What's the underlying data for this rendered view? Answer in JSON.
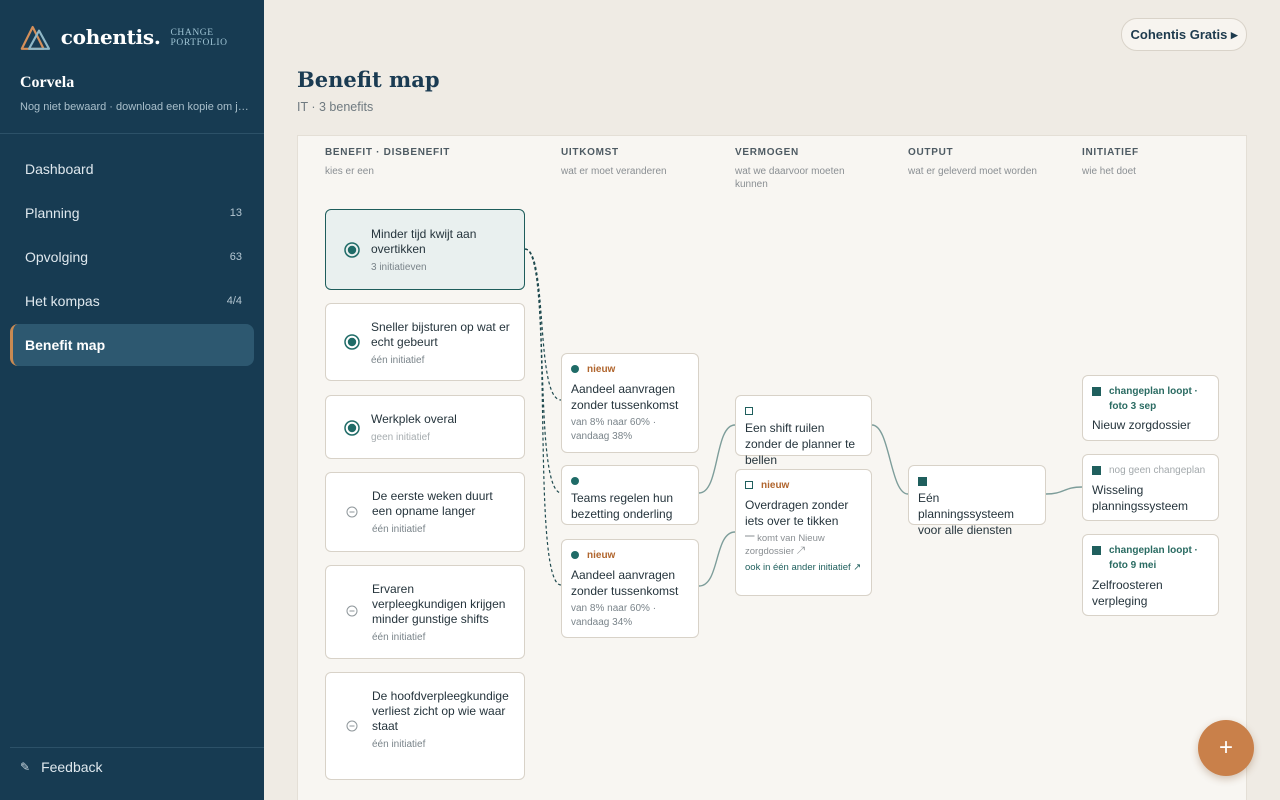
{
  "brand": {
    "name": "cohentis.",
    "tagline": "CHANGE PORTFOLIO"
  },
  "org": {
    "name": "Corvela",
    "status": "Nog niet bewaard · download een kopie om je ..."
  },
  "nav": [
    {
      "label": "Dashboard",
      "count": ""
    },
    {
      "label": "Planning",
      "count": "13"
    },
    {
      "label": "Opvolging",
      "count": "63"
    },
    {
      "label": "Het kompas",
      "count": "4/4"
    },
    {
      "label": "Benefit map",
      "count": ""
    }
  ],
  "feedback": {
    "icon": "pencil-icon",
    "label": "Feedback"
  },
  "header": {
    "gratis_label": "Cohentis Gratis ▸"
  },
  "page": {
    "title": "Benefit map",
    "subtitle": "IT · 3 benefits"
  },
  "columns": [
    {
      "title": "BENEFIT · DISBENEFIT",
      "sub": "kies er een"
    },
    {
      "title": "UITKOMST",
      "sub": "wat er moet veranderen"
    },
    {
      "title": "VERMOGEN",
      "sub": "wat we daarvoor moeten kunnen"
    },
    {
      "title": "OUTPUT",
      "sub": "wat er geleverd moet worden"
    },
    {
      "title": "INITIATIEF",
      "sub": "wie het doet"
    }
  ],
  "benefits": [
    {
      "title": "Minder tijd kwijt aan overtikken",
      "sub": "3 initiatieven",
      "kind": "benefit",
      "selected": true
    },
    {
      "title": "Sneller bijsturen op wat er echt gebeurt",
      "sub": "één initiatief",
      "kind": "benefit"
    },
    {
      "title": "Werkplek overal",
      "sub": "geen initiatief",
      "kind": "benefit"
    },
    {
      "title": "De eerste weken duurt een opname langer",
      "sub": "één initiatief",
      "kind": "disbenefit"
    },
    {
      "title": "Ervaren verpleegkundigen krijgen minder gunstige shifts",
      "sub": "één initiatief",
      "kind": "disbenefit"
    },
    {
      "title": "De hoofdverpleegkundige verliest zicht op wie waar staat",
      "sub": "één initiatief",
      "kind": "disbenefit"
    }
  ],
  "outcomes": [
    {
      "tag": "nieuw",
      "title": "Aandeel aanvragen zonder tussenkomst",
      "sub": "van 8% naar 60% · vandaag 38%"
    },
    {
      "tag": "",
      "title": "Teams regelen hun bezetting onderling",
      "sub": ""
    },
    {
      "tag": "nieuw",
      "title": "Aandeel aanvragen zonder tussenkomst",
      "sub": "van 8% naar 60% · vandaag 34%"
    }
  ],
  "capabilities": [
    {
      "tag": "",
      "title": "Een shift ruilen zonder de planner te bellen"
    },
    {
      "tag": "nieuw",
      "title": "Overdragen zonder iets over te tikken",
      "note": "⎻ komt van Nieuw zorgdossier ↗",
      "link": "ook in één ander initiatief ↗"
    }
  ],
  "outputs": [
    {
      "title": "Eén planningssysteem voor alle diensten"
    }
  ],
  "initiatives": [
    {
      "status": "changeplan loopt · foto 3 sep",
      "title": "Nieuw zorgdossier",
      "active": true
    },
    {
      "status": "nog geen changeplan",
      "title": "Wisseling planningssysteem",
      "active": false
    },
    {
      "status": "changeplan loopt · foto 9 mei",
      "title": "Zelfroosteren verpleging",
      "active": true
    }
  ],
  "fab": {
    "label": "+"
  },
  "colors": {
    "sidebar": "#173b52",
    "accent": "#c9804a",
    "teal": "#1f6b67",
    "new_tag": "#b0652d",
    "background": "#efebe4"
  }
}
